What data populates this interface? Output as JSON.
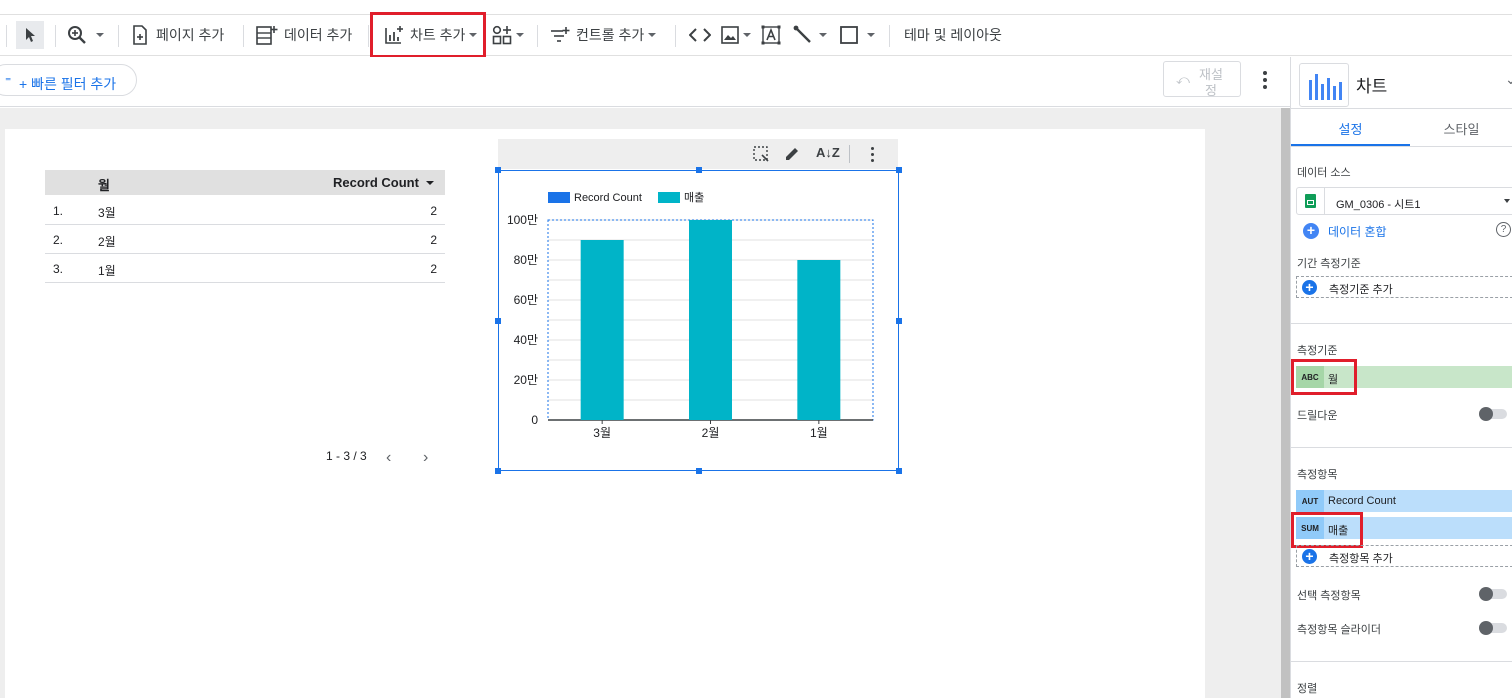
{
  "toolbar": {
    "add_page": "페이지 추가",
    "add_data": "데이터 추가",
    "add_chart": "차트 추가",
    "add_control": "컨트롤 추가",
    "theme_layout": "테마 및 레이아웃"
  },
  "filterbar": {
    "quick_filter": "+ 빠른 필터 추가",
    "reset_line1": "재설",
    "reset_line2": "정"
  },
  "table": {
    "col_month": "월",
    "col_count": "Record Count",
    "rows": [
      {
        "idx": "1.",
        "month": "3월",
        "count": "2"
      },
      {
        "idx": "2.",
        "month": "2월",
        "count": "2"
      },
      {
        "idx": "3.",
        "month": "1월",
        "count": "2"
      }
    ],
    "pagination": "1 - 3 / 3"
  },
  "chart_data": {
    "type": "bar",
    "categories": [
      "3월",
      "2월",
      "1월"
    ],
    "series": [
      {
        "name": "Record Count",
        "color": "#1a73e8",
        "values": [
          2,
          2,
          2
        ]
      },
      {
        "name": "매출",
        "color": "#00b4c8",
        "values": [
          900000,
          1000000,
          800000
        ]
      }
    ],
    "ylim": [
      0,
      1000000
    ],
    "yticks": [
      "0",
      "20만",
      "40만",
      "60만",
      "80만",
      "100만"
    ],
    "grid": true,
    "legend": "top-left"
  },
  "panel": {
    "title": "차트",
    "tab_setup": "설정",
    "tab_style": "스타일",
    "data_source_label": "데이터 소스",
    "data_source_name": "GM_0306 - 시트1",
    "blend_data": "데이터 혼합",
    "date_dimension_label": "기간 측정기준",
    "add_dimension": "측정기준 추가",
    "dimension_label": "측정기준",
    "dimension_tag": "ABC",
    "dimension_name": "월",
    "drilldown": "드릴다운",
    "metric_label": "측정항목",
    "metric1_tag": "AUT",
    "metric1_name": "Record Count",
    "metric2_tag": "SUM",
    "metric2_name": "매출",
    "add_metric": "측정항목 추가",
    "optional_metrics": "선택 측정항목",
    "metric_sliders": "측정항목 슬라이더",
    "sort_label": "정렬"
  }
}
